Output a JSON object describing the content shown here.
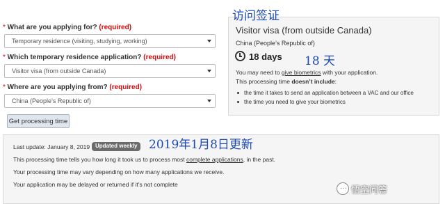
{
  "form": {
    "questions": [
      {
        "star": "*",
        "label": " What are you applying for? ",
        "required": "(required)",
        "selected": "Temporary residence (visiting, studying, working)"
      },
      {
        "star": "*",
        "label": " Which temporary residence application? ",
        "required": "(required)",
        "selected": "Visitor visa (from outside Canada)"
      },
      {
        "star": "*",
        "label": " Where are you applying from? ",
        "required": "(required)",
        "selected": "China (People’s Republic of)"
      }
    ],
    "button_label": "Get processing time"
  },
  "result": {
    "title": "Visitor visa (from outside Canada)",
    "country": "China (People’s Republic of)",
    "days": "18 days",
    "biometrics_prefix": "You may need to ",
    "biometrics_link": "give biometrics",
    "biometrics_suffix": " with your application.",
    "time_prefix": "This processing time ",
    "time_bold": "doesn’t include",
    "time_suffix": ":",
    "bullets": [
      "the time it takes to send an application between a VAC and our office",
      "the time you need to give your biometrics"
    ]
  },
  "info": {
    "last_update": "Last update: January 8, 2019",
    "badge": "Updated weekly",
    "line1_prefix": "This processing time tells you how long it took us to process most ",
    "line1_link": "complete applications",
    "line1_suffix": ", in the past.",
    "line2": "Your processing time may vary depending on how many applications we receive.",
    "line3": "Your application may be delayed or returned if it’s not complete"
  },
  "annotations": {
    "visa": "访问签证",
    "days": "18  天",
    "date": "2019年1月8日更新"
  },
  "watermark": "悟空问答",
  "colors": {
    "required": "#d3080c",
    "annotation": "#1c49b4",
    "badge": "#6b6b6b"
  }
}
